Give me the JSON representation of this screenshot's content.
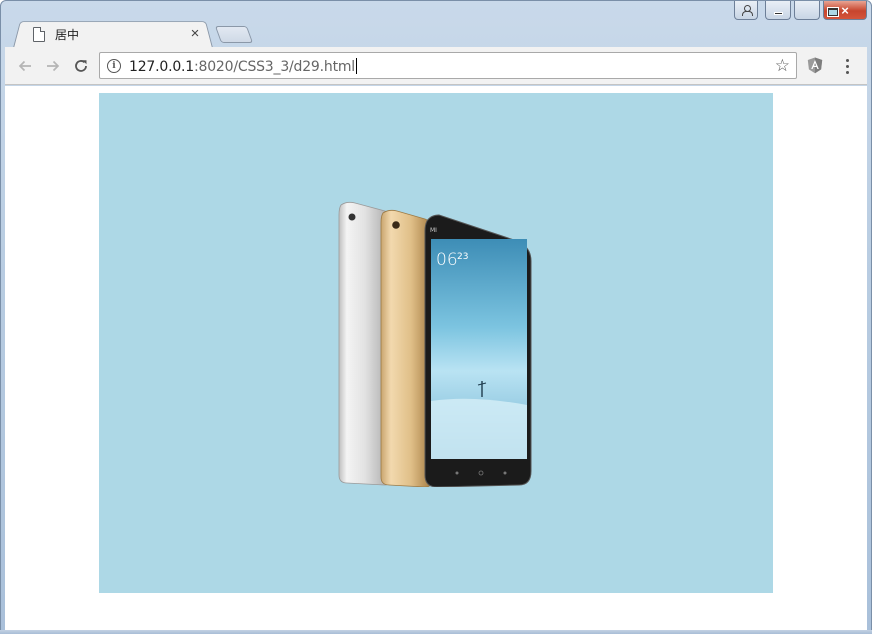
{
  "browser": {
    "tab": {
      "title": "居中",
      "close_label": "×"
    },
    "address": {
      "host": "127.0.0.1",
      "path": ":8020/CSS3_3/d29.html"
    },
    "icons": {
      "back": "arrow-left-icon",
      "forward": "arrow-right-icon",
      "reload": "reload-icon",
      "info": "info-icon",
      "bookmark": "star-icon",
      "extension": "angular-extension-icon",
      "menu": "kebab-menu-icon"
    },
    "window_controls": {
      "close_label": "×"
    }
  },
  "page": {
    "box_color": "#add8e6",
    "image": {
      "name": "product-image",
      "label": "MI"
    }
  }
}
